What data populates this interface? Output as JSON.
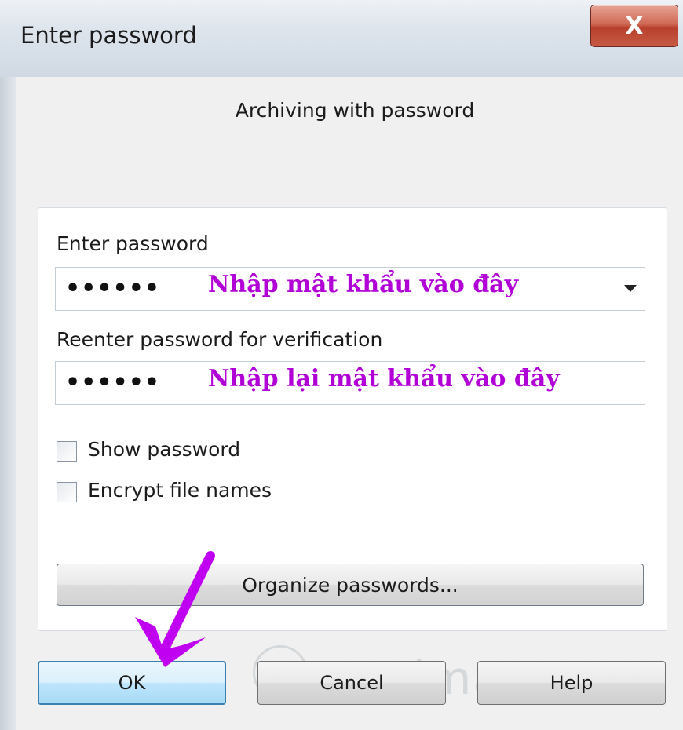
{
  "window": {
    "title": "Enter password",
    "close_glyph": "X"
  },
  "dialog": {
    "subtitle": "Archiving with password",
    "enter_label": "Enter password",
    "enter_value": "••••••",
    "enter_hint": "Nhập mật khẩu vào đây",
    "reenter_label": "Reenter password for verification",
    "reenter_value": "••••••",
    "reenter_hint": "Nhập lại mật khẩu vào đây",
    "show_password_label": "Show password",
    "show_password_checked": false,
    "encrypt_names_label": "Encrypt file names",
    "encrypt_names_checked": false,
    "organize_label": "Organize passwords...",
    "ok_label": "OK",
    "cancel_label": "Cancel",
    "help_label": "Help"
  },
  "annotation": {
    "arrow_color": "#c000f0",
    "hint_color": "#b100d6"
  },
  "watermark": {
    "text": "uantrimang",
    "icon": "lightbulb-icon"
  }
}
